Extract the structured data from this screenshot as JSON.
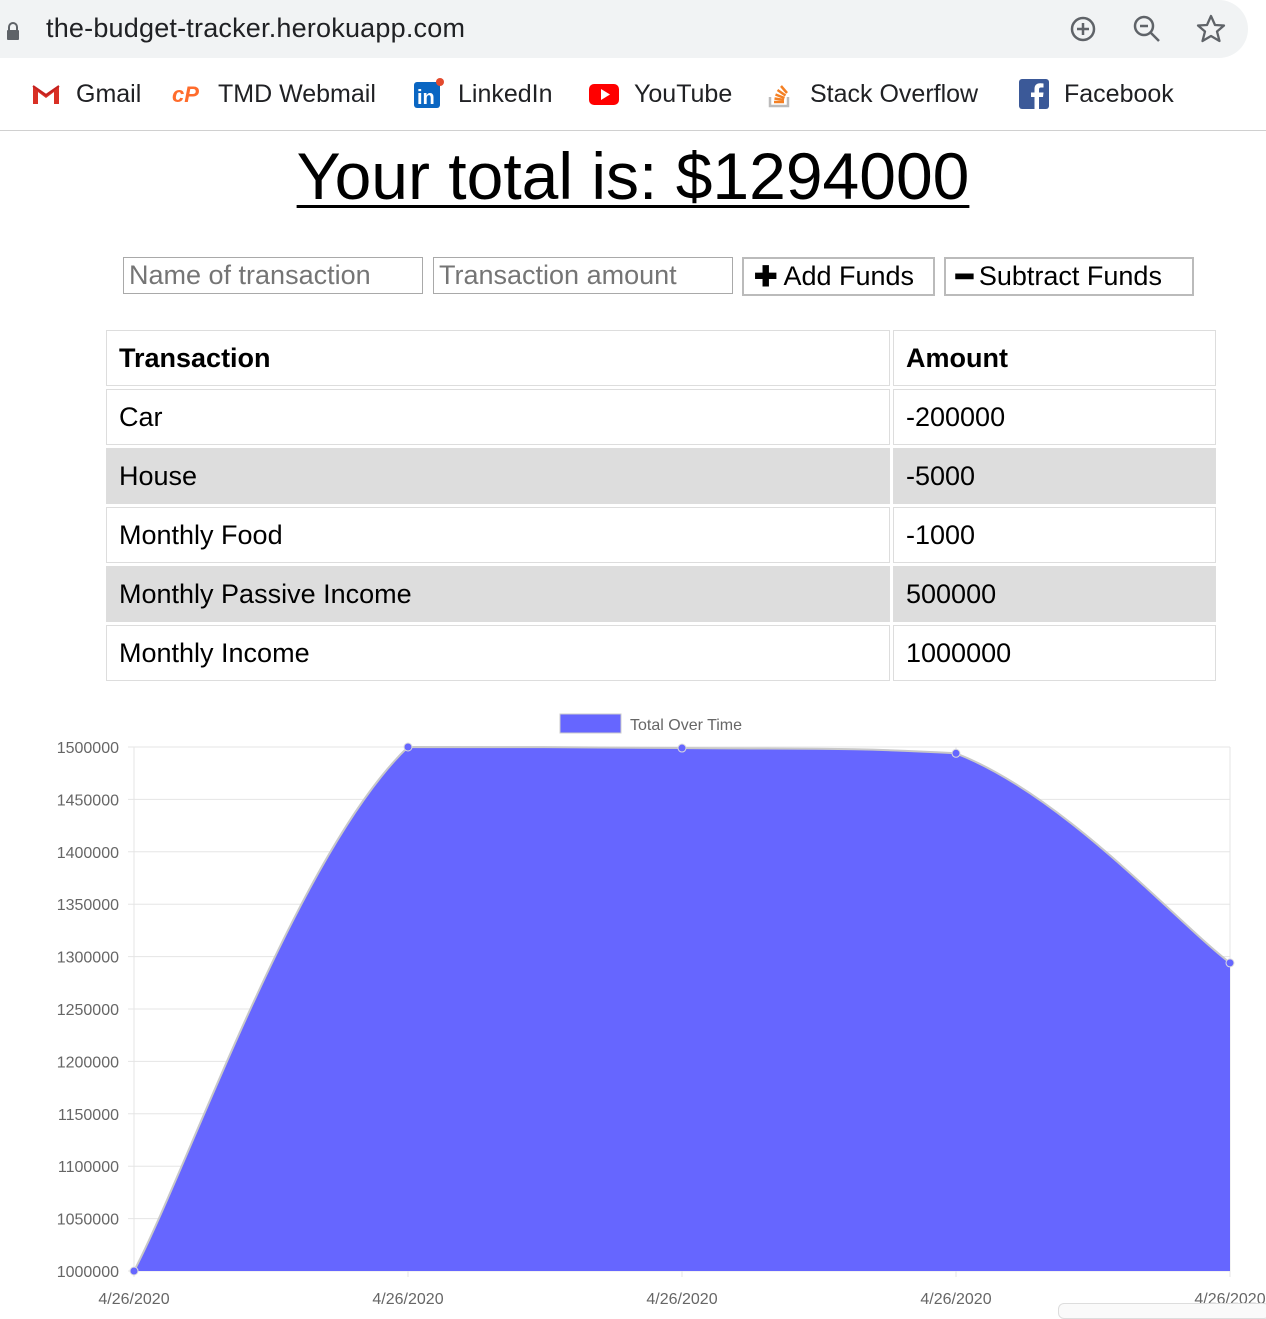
{
  "browser": {
    "url": "the-budget-tracker.herokuapp.com",
    "bookmarks": [
      {
        "label": "Gmail",
        "icon": "gmail-icon"
      },
      {
        "label": "TMD Webmail",
        "icon": "cpanel-icon"
      },
      {
        "label": "LinkedIn",
        "icon": "linkedin-icon"
      },
      {
        "label": "YouTube",
        "icon": "youtube-icon"
      },
      {
        "label": "Stack Overflow",
        "icon": "stackoverflow-icon"
      },
      {
        "label": "Facebook",
        "icon": "facebook-icon"
      }
    ]
  },
  "page": {
    "total_label": "Your total is: $1294000",
    "name_placeholder": "Name of transaction",
    "amount_placeholder": "Transaction amount",
    "add_label": "Add Funds",
    "subtract_label": "Subtract Funds"
  },
  "table": {
    "headers": [
      "Transaction",
      "Amount"
    ],
    "rows": [
      {
        "name": "Car",
        "amount": "-200000"
      },
      {
        "name": "House",
        "amount": "-5000"
      },
      {
        "name": "Monthly Food",
        "amount": "-1000"
      },
      {
        "name": "Monthly Passive Income",
        "amount": "500000"
      },
      {
        "name": "Monthly Income",
        "amount": "1000000"
      }
    ]
  },
  "chart_data": {
    "type": "area",
    "x": [
      "4/26/2020",
      "4/26/2020",
      "4/26/2020",
      "4/26/2020",
      "4/26/2020"
    ],
    "series": [
      {
        "name": "Total Over Time",
        "values": [
          1000000,
          1500000,
          1499000,
          1494000,
          1294000
        ],
        "color": "#6666ff"
      }
    ],
    "ylim": [
      1000000,
      1500000
    ],
    "yticks": [
      "1500000",
      "1450000",
      "1400000",
      "1350000",
      "1300000",
      "1250000",
      "1200000",
      "1150000",
      "1100000",
      "1050000",
      "1000000"
    ],
    "legend": "top-center",
    "grid": true
  }
}
